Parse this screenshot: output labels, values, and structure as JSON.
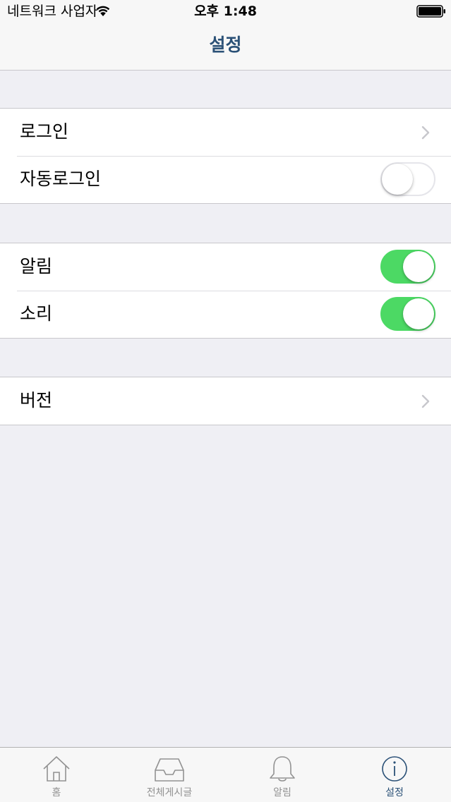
{
  "status_bar": {
    "carrier": "네트워크 사업자",
    "time": "오후 1:48"
  },
  "nav": {
    "title": "설정"
  },
  "groups": [
    {
      "cells": [
        {
          "label": "로그인",
          "accessory": "chevron-icon"
        },
        {
          "label": "자동로그인",
          "accessory": "switch",
          "switch_on": false
        }
      ]
    },
    {
      "cells": [
        {
          "label": "알림",
          "accessory": "switch",
          "switch_on": true
        },
        {
          "label": "소리",
          "accessory": "switch",
          "switch_on": true
        }
      ]
    },
    {
      "cells": [
        {
          "label": "버전",
          "accessory": "chevron-icon"
        }
      ]
    }
  ],
  "tab_bar": {
    "items": [
      {
        "label": "홈",
        "icon": "home-icon",
        "selected": false
      },
      {
        "label": "전체게시글",
        "icon": "inbox-tray-icon",
        "selected": false
      },
      {
        "label": "알림",
        "icon": "bell-icon",
        "selected": false
      },
      {
        "label": "설정",
        "icon": "info-icon",
        "selected": true
      }
    ]
  },
  "colors": {
    "accent": "#2b5177",
    "switch_on": "#4cd964",
    "background": "#efeff4",
    "tab_inactive": "#929292"
  }
}
